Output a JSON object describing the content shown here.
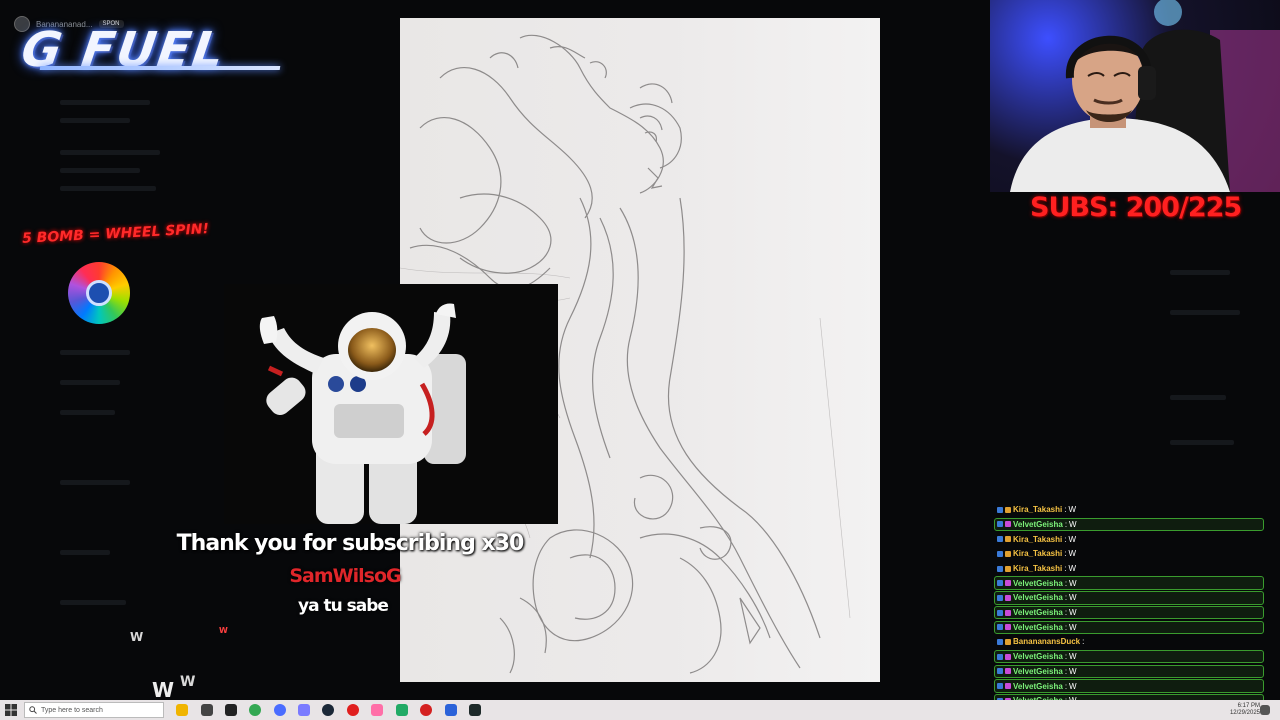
{
  "overlay": {
    "follower_name": "Bananananad...",
    "follower_tag": "SPON",
    "brand_logo": "G FUEL",
    "wheel_promo": "5 BOMB = WHEEL SPIN!"
  },
  "alert": {
    "title": "Thank you for subscribing x30",
    "username": "SamWilsoG",
    "message": "ya tu sabe"
  },
  "subs_goal": "SUBS: 200/225",
  "chat": [
    {
      "user": "Kira_Takashi",
      "msg": "W",
      "color": "#f5c243",
      "highlight": false
    },
    {
      "user": "VelvetGeisha",
      "msg": "W",
      "color": "#7cf27a",
      "highlight": true
    },
    {
      "user": "Kira_Takashi",
      "msg": "W",
      "color": "#f5c243",
      "highlight": false
    },
    {
      "user": "Kira_Takashi",
      "msg": "W",
      "color": "#f5c243",
      "highlight": false
    },
    {
      "user": "Kira_Takashi",
      "msg": "W",
      "color": "#f5c243",
      "highlight": false
    },
    {
      "user": "VelvetGeisha",
      "msg": "W",
      "color": "#7cf27a",
      "highlight": true
    },
    {
      "user": "VelvetGeisha",
      "msg": "W",
      "color": "#7cf27a",
      "highlight": true
    },
    {
      "user": "VelvetGeisha",
      "msg": "W",
      "color": "#7cf27a",
      "highlight": true
    },
    {
      "user": "VelvetGeisha",
      "msg": "W",
      "color": "#7cf27a",
      "highlight": true
    },
    {
      "user": "BanananansDuck",
      "msg": "",
      "color": "#f5c243",
      "highlight": false
    },
    {
      "user": "VelvetGeisha",
      "msg": "W",
      "color": "#7cf27a",
      "highlight": true
    },
    {
      "user": "VelvetGeisha",
      "msg": "W",
      "color": "#7cf27a",
      "highlight": true
    },
    {
      "user": "VelvetGeisha",
      "msg": "W",
      "color": "#7cf27a",
      "highlight": true
    },
    {
      "user": "VelvetGeisha",
      "msg": "W",
      "color": "#7cf27a",
      "highlight": true
    }
  ],
  "floating_ws": [
    "W",
    "W",
    "W",
    "W"
  ],
  "taskbar": {
    "search_placeholder": "Type here to search",
    "time": "6:17 PM",
    "date": "12/29/2025"
  },
  "colors": {
    "brand_glow": "#5d8cff",
    "goal_red": "#ff2020",
    "chat_green": "#7cf27a",
    "chat_gold": "#f5c243"
  }
}
